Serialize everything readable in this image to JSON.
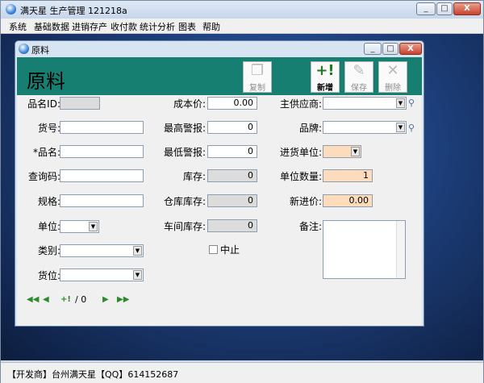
{
  "app": {
    "title": "满天星 生产管理 121218a"
  },
  "menu": [
    "系统",
    "基础数据",
    "进销存产",
    "收付款",
    "统计分析",
    "图表",
    "帮助"
  ],
  "child": {
    "title": "原料",
    "heading": "原料"
  },
  "toolbar": {
    "copy": "复制",
    "new": "新增",
    "save": "保存",
    "delete": "删除"
  },
  "form": {
    "pinming_id": {
      "label": "品名ID:",
      "value": ""
    },
    "huohao": {
      "label": "货号:",
      "value": ""
    },
    "pinming": {
      "label": "*品名:",
      "value": ""
    },
    "chaxunma": {
      "label": "查询码:",
      "value": ""
    },
    "guige": {
      "label": "规格:",
      "value": ""
    },
    "danwei": {
      "label": "单位:",
      "value": ""
    },
    "leibie": {
      "label": "类别:",
      "value": ""
    },
    "huowei": {
      "label": "货位:",
      "value": ""
    },
    "chengbenjia": {
      "label": "成本价:",
      "value": "0.00"
    },
    "zuigao": {
      "label": "最高警报:",
      "value": "0"
    },
    "zuidi": {
      "label": "最低警报:",
      "value": "0"
    },
    "kucun": {
      "label": "库存:",
      "value": "0"
    },
    "cangku": {
      "label": "仓库库存:",
      "value": "0"
    },
    "chejian": {
      "label": "车间库存:",
      "value": "0"
    },
    "zhongzhi": {
      "label": "中止",
      "checked": false
    },
    "gongyingshang": {
      "label": "主供应商:",
      "value": ""
    },
    "pinpai": {
      "label": "品牌:",
      "value": ""
    },
    "jinhuodanwei": {
      "label": "进货单位:",
      "value": ""
    },
    "danweishuliang": {
      "label": "单位数量:",
      "value": "1"
    },
    "xinjinjia": {
      "label": "新进价:",
      "value": "0.00"
    },
    "beizhu": {
      "label": "备注:",
      "value": ""
    }
  },
  "nav": {
    "counter": "/ 0"
  },
  "status": {
    "developer": "【开发商】台州满天星",
    "qq": "【QQ】614152687"
  },
  "icons": [
    "app-icon",
    "minimize-icon",
    "maximize-icon",
    "close-icon",
    "copy-icon",
    "new-icon",
    "save-icon",
    "delete-icon",
    "search-icon",
    "first-icon",
    "prev-icon",
    "add-record-icon",
    "next-icon",
    "last-icon"
  ],
  "colors": {
    "header": "#177f72",
    "peach": "#fddcbc",
    "readonly": "#dcdcdc"
  }
}
